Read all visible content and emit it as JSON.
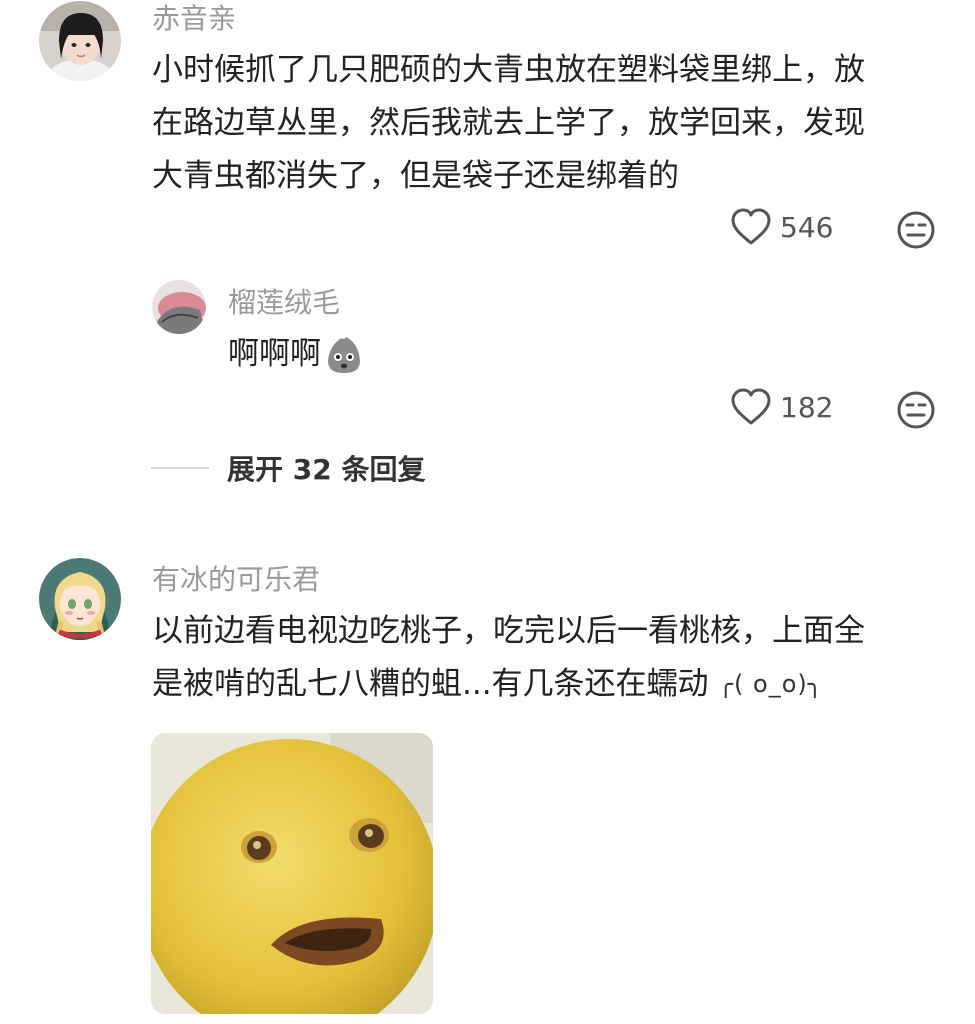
{
  "comments": [
    {
      "username": "赤音亲",
      "text_lines": [
        "小时候抓了几只肥硕的大青虫放在塑料袋里绑上，放",
        "在路边草丛里，然后我就去上学了，放学回来，发现",
        "大青虫都消失了，但是袋子还是绑着的"
      ],
      "likes": "546",
      "replies": [
        {
          "username": "榴莲绒毛",
          "text": "啊啊啊",
          "likes": "182"
        }
      ],
      "expand_label": "展开 32 条回复"
    },
    {
      "username": "有冰的可乐君",
      "text_lines": [
        "以前边看电视边吃桃子，吃完以后一看桃核，上面全",
        "是被啃的乱七八糟的蛆...有几条还在蠕动"
      ],
      "kaomoji": "╭( o_o)╮",
      "attachment": "surprised-lemon-meme"
    }
  ],
  "colors": {
    "username": "#9a9a9a",
    "text": "#222222",
    "icon": "#555555",
    "lemon": "#e3c23a"
  }
}
